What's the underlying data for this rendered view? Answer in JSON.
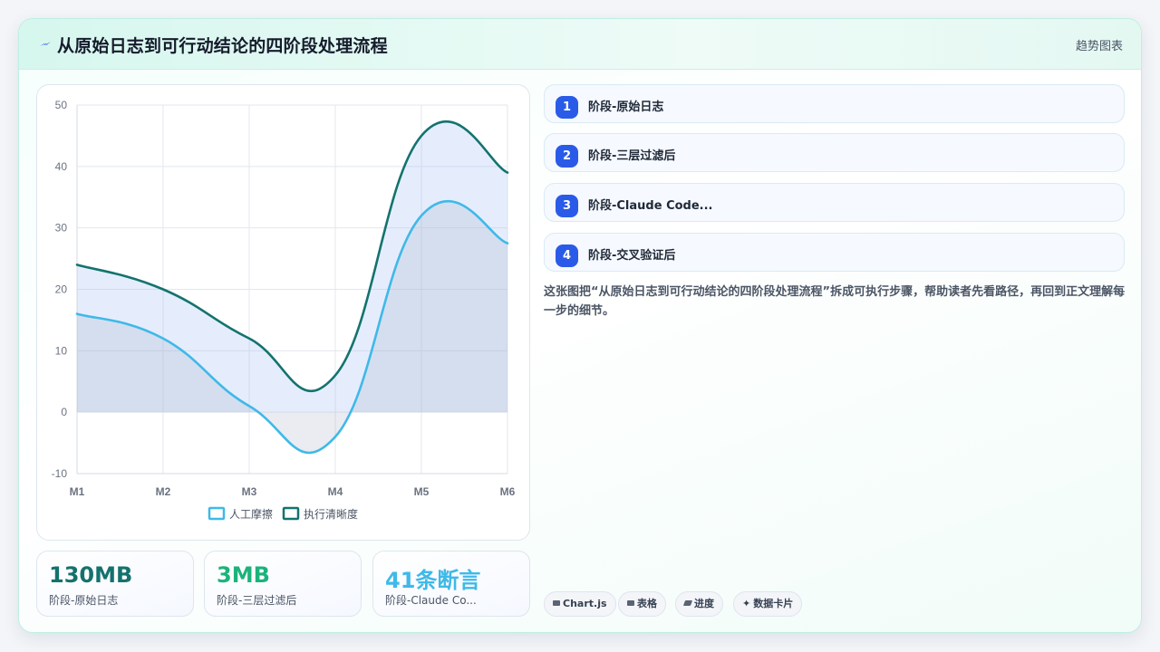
{
  "header": {
    "title": "从原始日志到可行动结论的四阶段处理流程",
    "tag": "趋势图表",
    "icon": "lightning-icon"
  },
  "chart_data": {
    "type": "line",
    "categories": [
      "M1",
      "M2",
      "M3",
      "M4",
      "M5",
      "M6"
    ],
    "ylim": [
      -10,
      50
    ],
    "yticks": [
      "50",
      "40",
      "30",
      "20",
      "10",
      "0",
      "-10"
    ],
    "grid": true,
    "legend": "bottom",
    "series": [
      {
        "name": "人工摩擦",
        "values": [
          16,
          12,
          1,
          -4,
          32,
          27.5
        ],
        "color": "#3fb9e8",
        "fill": "rgba(160,170,190,0.22)"
      },
      {
        "name": "执行清晰度",
        "values": [
          24,
          20,
          12,
          6,
          45,
          39
        ],
        "color": "#13736f",
        "fill": "rgba(170,195,245,0.30)"
      }
    ]
  },
  "stats": [
    {
      "value": "130MB",
      "label": "阶段-原始日志",
      "color": "#14726d"
    },
    {
      "value": "3MB",
      "label": "阶段-三层过滤后",
      "color": "#1bb37b"
    },
    {
      "value": "41条断言",
      "label": "阶段-Claude Co...",
      "color": "#3fb9e8"
    }
  ],
  "steps": [
    {
      "num": "1",
      "label": "阶段-原始日志"
    },
    {
      "num": "2",
      "label": "阶段-三层过滤后"
    },
    {
      "num": "3",
      "label": "阶段-Claude Code..."
    },
    {
      "num": "4",
      "label": "阶段-交叉验证后"
    }
  ],
  "description": "这张图把“从原始日志到可行动结论的四阶段处理流程”拆成可执行步骤，帮助读者先看路径，再回到正文理解每一步的细节。",
  "tags": [
    {
      "label": "Chart.js",
      "icon": "chart-icon"
    },
    {
      "label": "表格",
      "icon": "table-icon"
    },
    {
      "label": "进度",
      "icon": "progress-icon"
    },
    {
      "label": "数据卡片",
      "icon": "sparkle-icon"
    }
  ]
}
